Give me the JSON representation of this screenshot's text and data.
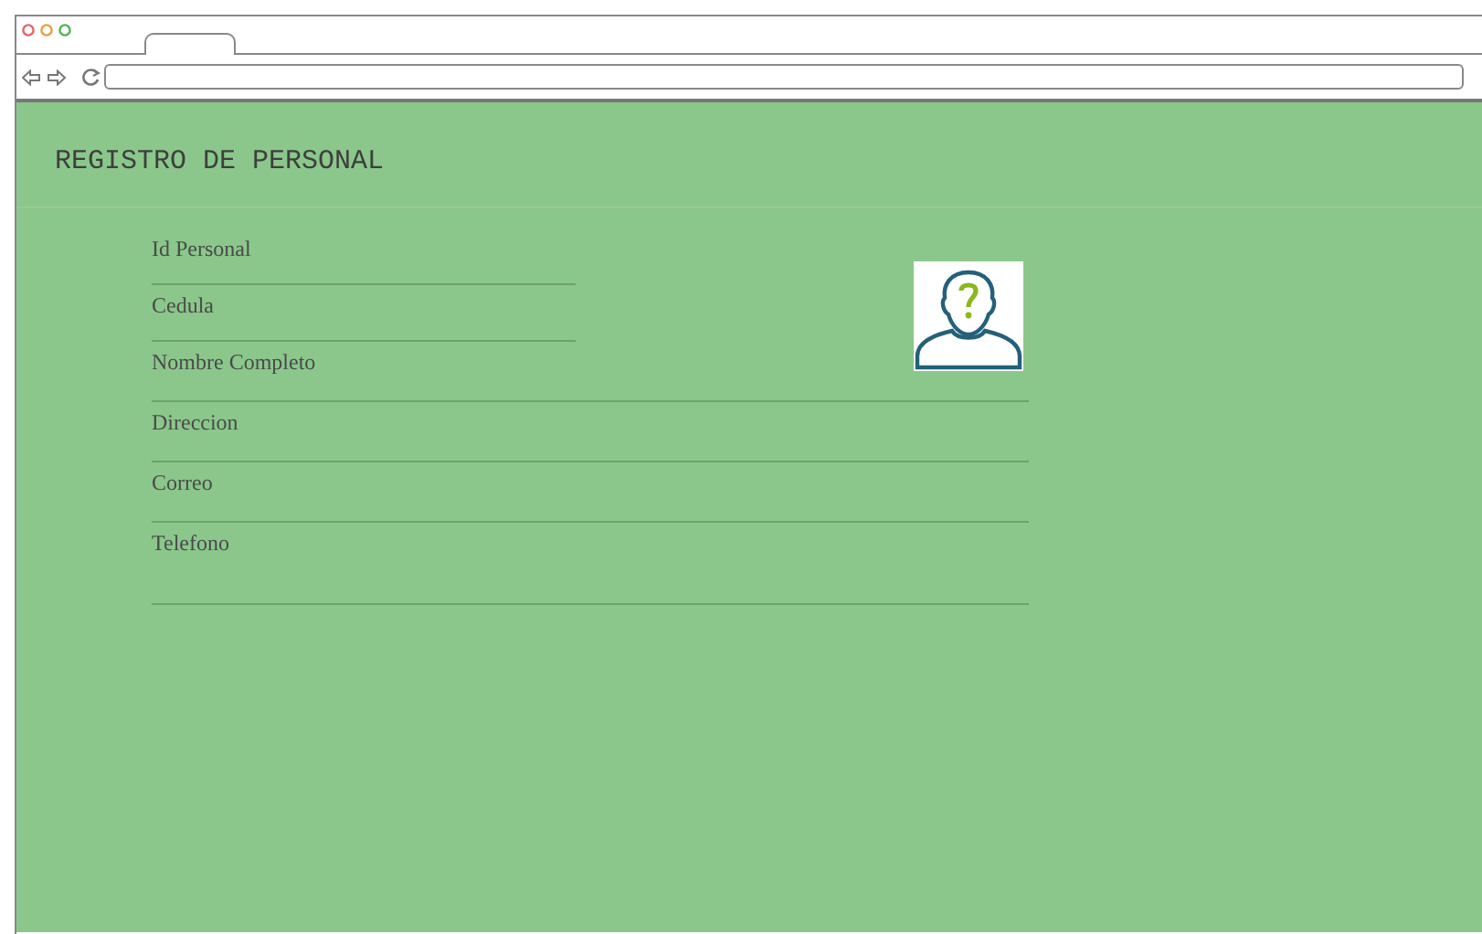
{
  "page": {
    "title": "REGISTRO DE PERSONAL"
  },
  "fields": [
    {
      "placeholder": "Id Personal",
      "kind": "short"
    },
    {
      "placeholder": "Cedula",
      "kind": "short"
    },
    {
      "placeholder": "Nombre Completo",
      "kind": "wide"
    },
    {
      "placeholder": "Direccion",
      "kind": "wide"
    },
    {
      "placeholder": "Correo",
      "kind": "wide"
    },
    {
      "placeholder": "Telefono",
      "kind": "area"
    }
  ]
}
